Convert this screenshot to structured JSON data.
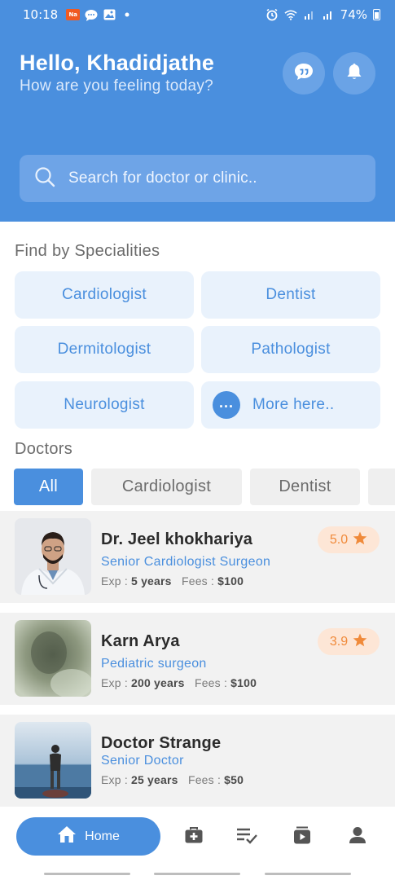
{
  "status_bar": {
    "time": "10:18",
    "badge_text": "Na",
    "battery": "74%"
  },
  "header": {
    "greeting": "Hello, Khadidjathe",
    "subtitle": "How are you feeling today?",
    "chat_icon": "chat-icon",
    "bell_icon": "bell-icon"
  },
  "search": {
    "placeholder": "Search for doctor or clinic.."
  },
  "specialities": {
    "title": "Find by Specialities",
    "items": [
      "Cardiologist",
      "Dentist",
      "Dermitologist",
      "Pathologist",
      "Neurologist",
      "More here.."
    ],
    "more_icon": "more-dots-icon"
  },
  "doctors": {
    "title": "Doctors",
    "filters": [
      "All",
      "Cardiologist",
      "Dentist"
    ],
    "list": [
      {
        "name": "Dr. Jeel khokhariya",
        "role": "Senior Cardiologist Surgeon",
        "exp_label": "Exp : ",
        "exp": "5 years",
        "fees_label": "Fees : ",
        "fees": "$100",
        "rating": "5.0"
      },
      {
        "name": "Karn Arya",
        "role": "Pediatric surgeon",
        "exp_label": "Exp : ",
        "exp": "200 years",
        "fees_label": "Fees : ",
        "fees": "$100",
        "rating": "3.9"
      },
      {
        "name": "Doctor Strange",
        "role": "Senior Doctor",
        "exp_label": "Exp : ",
        "exp": "25 years",
        "fees_label": "Fees : ",
        "fees": "$50",
        "rating": ""
      }
    ]
  },
  "bottom_nav": {
    "home_label": "Home",
    "icons": [
      "home-icon",
      "medical-kit-icon",
      "checklist-icon",
      "history-icon",
      "profile-icon"
    ]
  },
  "colors": {
    "primary": "#4a8fde",
    "rating_bg": "#fde6d6",
    "rating_text": "#f08a3a",
    "card_bg": "#e9f2fc"
  }
}
